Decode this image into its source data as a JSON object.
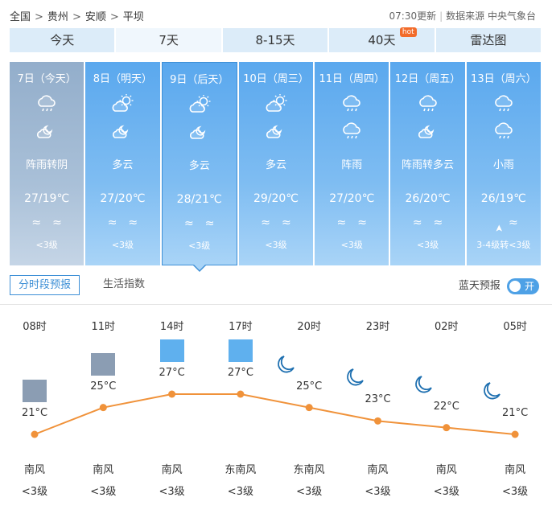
{
  "breadcrumb": [
    "全国",
    "贵州",
    "安顺",
    "平坝"
  ],
  "meta": {
    "update": "07:30更新",
    "source": "数据来源 中央气象台"
  },
  "tabs": [
    {
      "label": "今天",
      "active": false
    },
    {
      "label": "7天",
      "active": true
    },
    {
      "label": "8-15天",
      "active": false
    },
    {
      "label": "40天",
      "active": false,
      "badge": "hot"
    },
    {
      "label": "雷达图",
      "active": false
    }
  ],
  "days": [
    {
      "date": "7日（今天）",
      "icon1": "cloud-rain-icon",
      "icon2": "partly-cloudy-night-icon",
      "weather": "阵雨转阴",
      "temp": "27/19℃",
      "wind": [
        "≈",
        "≈"
      ],
      "level": "<3级",
      "past": true
    },
    {
      "date": "8日（明天）",
      "icon1": "partly-cloudy-day-icon",
      "icon2": "partly-cloudy-night-icon",
      "weather": "多云",
      "temp": "27/20℃",
      "wind": [
        "≈",
        "≈"
      ],
      "level": "<3级"
    },
    {
      "date": "9日（后天）",
      "icon1": "partly-cloudy-day-icon",
      "icon2": "partly-cloudy-night-icon",
      "weather": "多云",
      "temp": "28/21℃",
      "wind": [
        "≈",
        "≈"
      ],
      "level": "<3级",
      "selected": true
    },
    {
      "date": "10日（周三）",
      "icon1": "partly-cloudy-day-icon",
      "icon2": "partly-cloudy-night-icon",
      "weather": "多云",
      "temp": "29/20℃",
      "wind": [
        "≈",
        "≈"
      ],
      "level": "<3级"
    },
    {
      "date": "11日（周四）",
      "icon1": "cloud-rain-icon",
      "icon2": "cloud-rain-icon",
      "weather": "阵雨",
      "temp": "27/20℃",
      "wind": [
        "≈",
        "≈"
      ],
      "level": "<3级"
    },
    {
      "date": "12日（周五）",
      "icon1": "cloud-rain-icon",
      "icon2": "partly-cloudy-night-icon",
      "weather": "阵雨转多云",
      "temp": "26/20℃",
      "wind": [
        "≈",
        "≈"
      ],
      "level": "<3级"
    },
    {
      "date": "13日（周六）",
      "icon1": "cloud-rain-icon",
      "icon2": "cloud-rain-icon",
      "weather": "小雨",
      "temp": "26/19℃",
      "wind": [
        "➤",
        "≈"
      ],
      "level": "3-4级转<3级"
    }
  ],
  "subtabs": {
    "active": "分时段预报",
    "second": "生活指数"
  },
  "bluesky": {
    "label": "蓝天预报",
    "toggle": "开"
  },
  "hourly": [
    {
      "time": "08时",
      "temp": 21,
      "temp_label": "21°C",
      "icon": "partly-cloudy-day-icon",
      "wind": "南风",
      "level": "<3级"
    },
    {
      "time": "11时",
      "temp": 25,
      "temp_label": "25°C",
      "icon": "partly-cloudy-day-icon",
      "wind": "南风",
      "level": "<3级"
    },
    {
      "time": "14时",
      "temp": 27,
      "temp_label": "27°C",
      "icon": "partly-cloudy-day-blue-icon",
      "wind": "南风",
      "level": "<3级"
    },
    {
      "time": "17时",
      "temp": 27,
      "temp_label": "27°C",
      "icon": "partly-cloudy-day-blue-icon",
      "wind": "东南风",
      "level": "<3级"
    },
    {
      "time": "20时",
      "temp": 25,
      "temp_label": "25°C",
      "icon": "moon-icon",
      "wind": "东南风",
      "level": "<3级"
    },
    {
      "time": "23时",
      "temp": 23,
      "temp_label": "23°C",
      "icon": "moon-icon",
      "wind": "南风",
      "level": "<3级"
    },
    {
      "time": "02时",
      "temp": 22,
      "temp_label": "22°C",
      "icon": "moon-icon",
      "wind": "南风",
      "level": "<3级"
    },
    {
      "time": "05时",
      "temp": 21,
      "temp_label": "21°C",
      "icon": "moon-icon",
      "wind": "南风",
      "level": "<3级"
    }
  ],
  "colors": {
    "accent": "#3d8fd6",
    "line": "#f0923a",
    "tab_bg": "#dcecf9"
  }
}
